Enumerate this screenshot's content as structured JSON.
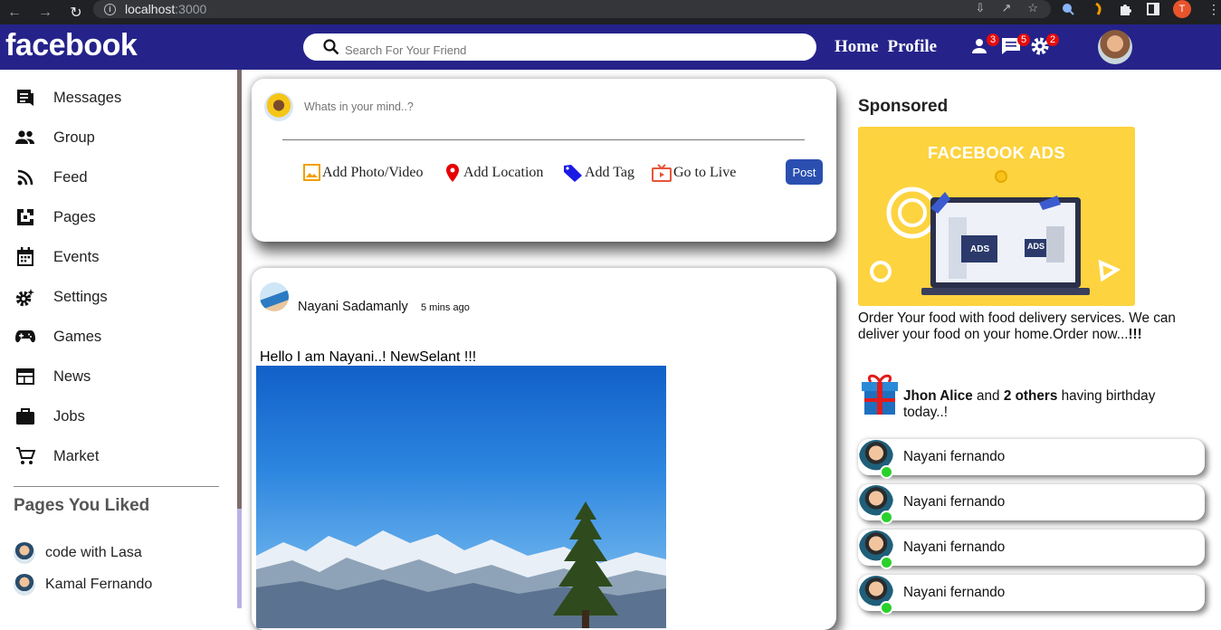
{
  "browser": {
    "url_host": "localhost",
    "url_port": ":3000",
    "profile_initial": "T"
  },
  "header": {
    "logo": "facebook",
    "search_placeholder": "Search For Your Friend",
    "links": [
      "Home",
      "Profile"
    ],
    "badges": {
      "friends": "3",
      "messages": "5",
      "settings": "2"
    }
  },
  "sidebar": {
    "items": [
      {
        "label": "Messages",
        "icon": "messages-icon"
      },
      {
        "label": "Group",
        "icon": "group-icon"
      },
      {
        "label": "Feed",
        "icon": "rss-feed-icon"
      },
      {
        "label": "Pages",
        "icon": "pages-icon"
      },
      {
        "label": "Events",
        "icon": "calendar-icon"
      },
      {
        "label": "Settings",
        "icon": "settings-icon"
      },
      {
        "label": "Games",
        "icon": "gamepad-icon"
      },
      {
        "label": "News",
        "icon": "news-icon"
      },
      {
        "label": "Jobs",
        "icon": "briefcase-icon"
      },
      {
        "label": "Market",
        "icon": "cart-icon"
      }
    ],
    "liked_heading": "Pages You Liked",
    "liked_pages": [
      "code with Lasa",
      "Kamal Fernando"
    ]
  },
  "composer": {
    "placeholder": "Whats in your mind..?",
    "actions": [
      "Add Photo/Video",
      "Add Location",
      "Add Tag",
      "Go to Live"
    ],
    "post_button": "Post"
  },
  "post": {
    "author": "Nayani Sadamanly",
    "time": "5 mins ago",
    "text": "Hello I am Nayani..! NewSelant !!!"
  },
  "rightbar": {
    "sponsored_heading": "Sponsored",
    "ad_title": "FACEBOOK ADS",
    "ad_tag": "ADS",
    "ad_desc_start": "Order Your food with food delivery services. We can deliver your food on your home.Order now...",
    "ad_desc_bold": "!!!",
    "birthday": {
      "name": "Jhon Alice",
      "and": " and ",
      "others": "2 others",
      "rest": " having birthday today..!"
    },
    "friends": [
      "Nayani fernando",
      "Nayani fernando",
      "Nayani fernando",
      "Nayani fernando"
    ]
  }
}
